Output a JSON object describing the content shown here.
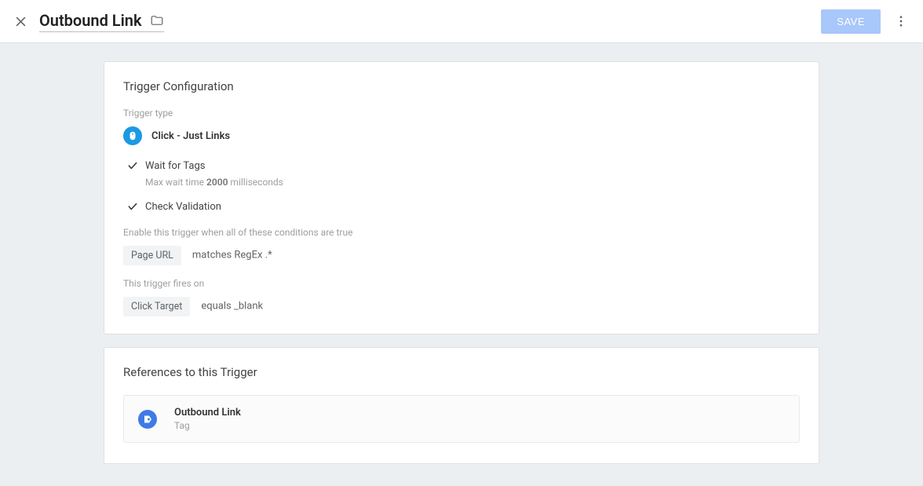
{
  "header": {
    "title": "Outbound Link",
    "save_label": "SAVE"
  },
  "config": {
    "card_title": "Trigger Configuration",
    "trigger_type_label": "Trigger type",
    "trigger_type_name": "Click - Just Links",
    "wait_for_tags_label": "Wait for Tags",
    "wait_prefix": "Max wait time ",
    "wait_value": "2000",
    "wait_suffix": " milliseconds",
    "check_validation_label": "Check Validation",
    "enable_conditions_label": "Enable this trigger when all of these conditions are true",
    "enable_chip": "Page URL",
    "enable_condition_text": "matches RegEx .*",
    "fires_on_label": "This trigger fires on",
    "fires_chip": "Click Target",
    "fires_condition_text": "equals _blank"
  },
  "refs": {
    "title": "References to this Trigger",
    "item_name": "Outbound Link",
    "item_type": "Tag"
  }
}
